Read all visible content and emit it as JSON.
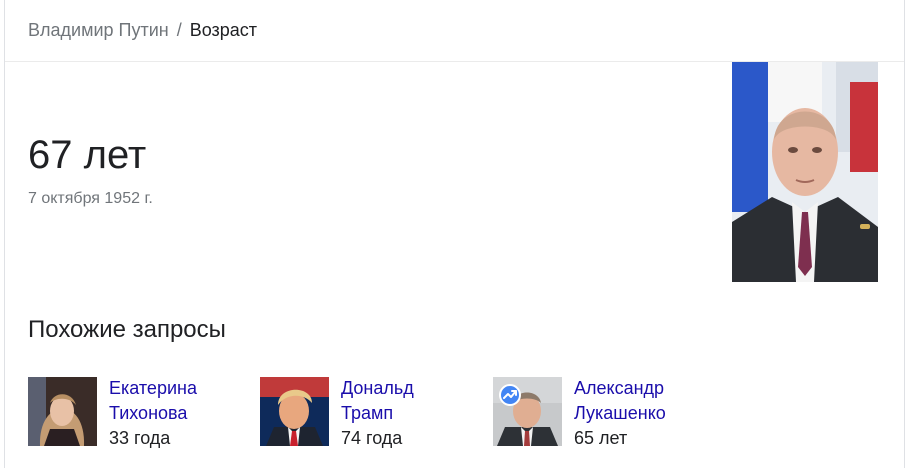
{
  "breadcrumb": {
    "entity": "Владимир Путин",
    "separator": "/",
    "attribute": "Возраст"
  },
  "answer": {
    "age": "67 лет",
    "birth_date": "7 октября 1952 г."
  },
  "related": {
    "title": "Похожие запросы",
    "items": [
      {
        "name_line1": "Екатерина",
        "name_line2": "Тихонова",
        "age": "33 года"
      },
      {
        "name_line1": "Дональд",
        "name_line2": "Трамп",
        "age": "74 года"
      },
      {
        "name_line1": "Александр",
        "name_line2": "Лукашенко",
        "age": "65 лет",
        "badge_icon": "trending-up-icon"
      }
    ]
  },
  "colors": {
    "link": "#1a0dab",
    "text": "#202124",
    "secondary": "#70757a",
    "badge": "#4285f4"
  }
}
